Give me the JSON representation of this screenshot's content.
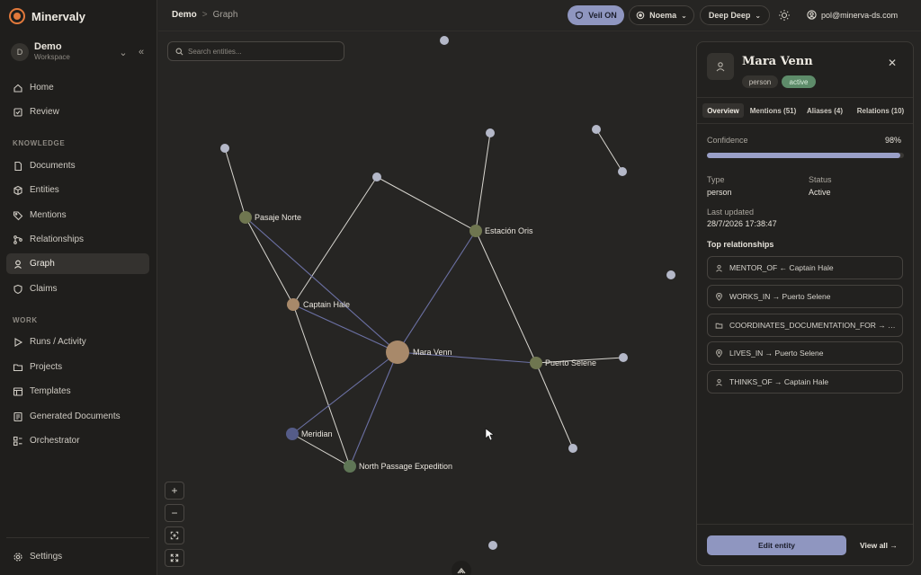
{
  "brand": {
    "name": "Minervaly",
    "accent": "#e2793b"
  },
  "workspace": {
    "avatar": "D",
    "name": "Demo",
    "sub": "Workspace"
  },
  "nav": {
    "main": [
      {
        "label": "Home",
        "icon": "home-icon"
      },
      {
        "label": "Review",
        "icon": "review-icon"
      }
    ],
    "knowledge_title": "KNOWLEDGE",
    "knowledge": [
      {
        "label": "Documents",
        "icon": "document-icon"
      },
      {
        "label": "Entities",
        "icon": "cube-icon"
      },
      {
        "label": "Mentions",
        "icon": "tag-icon"
      },
      {
        "label": "Relationships",
        "icon": "relationship-icon"
      },
      {
        "label": "Graph",
        "icon": "graph-icon",
        "active": true
      },
      {
        "label": "Claims",
        "icon": "shield-icon"
      }
    ],
    "work_title": "WORK",
    "work": [
      {
        "label": "Runs / Activity",
        "icon": "play-icon"
      },
      {
        "label": "Projects",
        "icon": "folder-icon"
      },
      {
        "label": "Templates",
        "icon": "template-icon"
      },
      {
        "label": "Generated Documents",
        "icon": "generated-doc-icon"
      },
      {
        "label": "Orchestrator",
        "icon": "orchestrator-icon"
      }
    ],
    "settings": "Settings"
  },
  "topbar": {
    "crumb_root": "Demo",
    "crumb_sep": ">",
    "crumb_current": "Graph",
    "veil": "Veil ON",
    "model": "Noema",
    "mode": "Deep Deep",
    "user": "pol@minerva-ds.com"
  },
  "search": {
    "placeholder": "Search entities..."
  },
  "zoom": {
    "in": "+",
    "out": "−"
  },
  "graph": {
    "nodes": [
      {
        "label": "Mara Venn",
        "color": "#a8896a"
      },
      {
        "label": "Pasaje Norte",
        "color": "#6f7650"
      },
      {
        "label": "Captain Hale",
        "color": "#a8896a"
      },
      {
        "label": "Estación Oris",
        "color": "#6f7650"
      },
      {
        "label": "Puerto Selene",
        "color": "#6f7650"
      },
      {
        "label": "Meridian",
        "color": "#555c88"
      },
      {
        "label": "North Passage Expedition",
        "color": "#5f7656"
      }
    ]
  },
  "panel": {
    "title": "Mara Venn",
    "tags": {
      "type": "person",
      "status": "active"
    },
    "tabs": [
      "Overview",
      "Mentions (51)",
      "Aliases (4)",
      "Relations (10)"
    ],
    "confidence_label": "Confidence",
    "confidence_value": "98%",
    "confidence": 0.98,
    "type_label": "Type",
    "type_value": "person",
    "status_label": "Status",
    "status_value": "Active",
    "updated_label": "Last updated",
    "updated_value": "28/7/2026 17:38:47",
    "relations_title": "Top relationships",
    "relations": [
      {
        "icon": "person-icon",
        "text": "MENTOR_OF ← Captain Hale"
      },
      {
        "icon": "location-icon",
        "text": "WORKS_IN → Puerto Selene"
      },
      {
        "icon": "folder-icon",
        "text": "COORDINATES_DOCUMENTATION_FOR → North Passage Expedition"
      },
      {
        "icon": "location-icon",
        "text": "LIVES_IN → Puerto Selene"
      },
      {
        "icon": "person-icon",
        "text": "THINKS_OF → Captain Hale"
      }
    ],
    "edit": "Edit entity",
    "view_all": "View all →"
  }
}
